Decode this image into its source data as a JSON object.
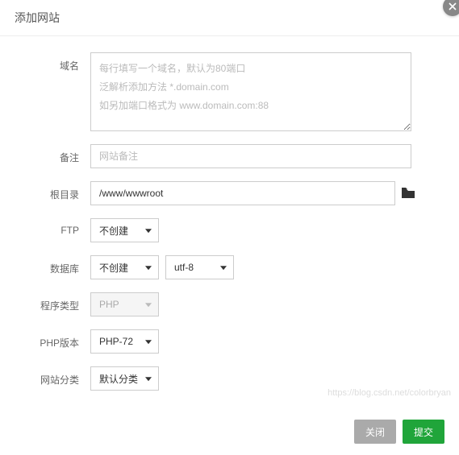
{
  "dialog": {
    "title": "添加网站"
  },
  "form": {
    "domain": {
      "label": "域名",
      "placeholder": "每行填写一个域名，默认为80端口\n泛解析添加方法 *.domain.com\n如另加端口格式为 www.domain.com:88",
      "value": ""
    },
    "remark": {
      "label": "备注",
      "placeholder": "网站备注",
      "value": ""
    },
    "root": {
      "label": "根目录",
      "value": "/www/wwwroot"
    },
    "ftp": {
      "label": "FTP",
      "value": "不创建"
    },
    "database": {
      "label": "数据库",
      "value": "不创建",
      "charset": "utf-8"
    },
    "program": {
      "label": "程序类型",
      "value": "PHP"
    },
    "php": {
      "label": "PHP版本",
      "value": "PHP-72"
    },
    "category": {
      "label": "网站分类",
      "value": "默认分类"
    }
  },
  "footer": {
    "cancel": "关闭",
    "submit": "提交"
  },
  "watermark": "https://blog.csdn.net/colorbryan"
}
